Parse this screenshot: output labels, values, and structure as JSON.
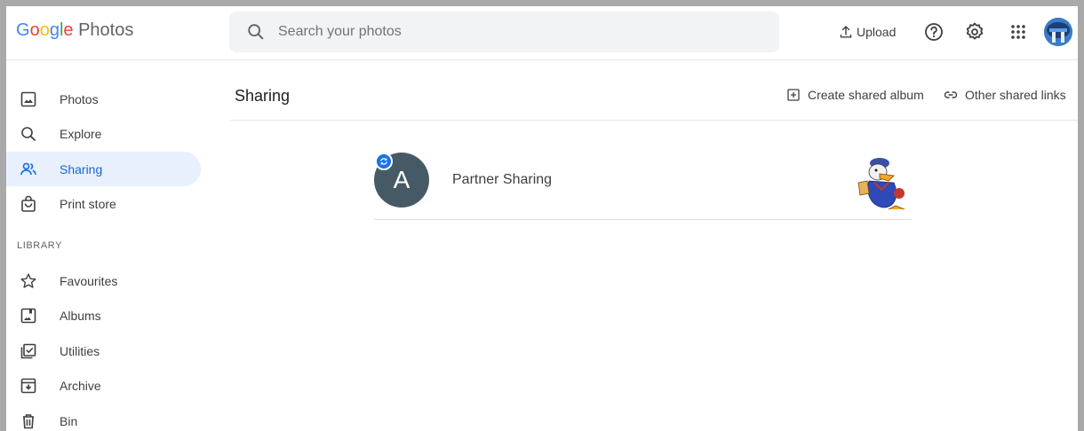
{
  "app": {
    "logo_google": [
      "G",
      "o",
      "o",
      "g",
      "l",
      "e"
    ],
    "logo_word": "Photos"
  },
  "search": {
    "placeholder": "Search your photos",
    "value": ""
  },
  "toolbar": {
    "upload_label": "Upload",
    "icons": [
      "help-icon",
      "settings-icon",
      "apps-grid-icon"
    ]
  },
  "sidebar": {
    "items": [
      {
        "label": "Photos",
        "icon": "photo-icon",
        "active": false
      },
      {
        "label": "Explore",
        "icon": "search-icon",
        "active": false
      },
      {
        "label": "Sharing",
        "icon": "people-icon",
        "active": true
      },
      {
        "label": "Print store",
        "icon": "shopping-bag-icon",
        "active": false
      }
    ],
    "library_label": "LIBRARY",
    "library_items": [
      {
        "label": "Favourites",
        "icon": "star-icon"
      },
      {
        "label": "Albums",
        "icon": "album-icon"
      },
      {
        "label": "Utilities",
        "icon": "utilities-icon"
      },
      {
        "label": "Archive",
        "icon": "archive-icon"
      },
      {
        "label": "Bin",
        "icon": "bin-icon"
      }
    ]
  },
  "main": {
    "title": "Sharing",
    "actions": {
      "create_shared_album": "Create shared album",
      "other_shared_links": "Other shared links"
    },
    "shares": [
      {
        "avatar_letter": "A",
        "name": "Partner Sharing",
        "thumbnail": "cartoon-duck-thumbnail"
      }
    ]
  },
  "colors": {
    "accent": "#1a73e8",
    "active_bg": "#e8f0fe",
    "avatar_bg": "#455a64",
    "search_bg": "#f1f3f4"
  }
}
